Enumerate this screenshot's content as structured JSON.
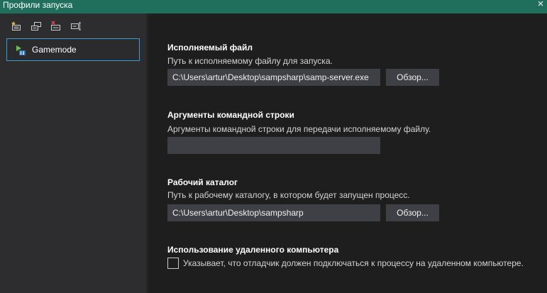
{
  "window": {
    "title": "Профили запуска",
    "close_glyph": "×",
    "accent_color": "#1f6f5c"
  },
  "toolbar": {
    "buttons": [
      {
        "name": "new-profile-icon"
      },
      {
        "name": "copy-profile-icon"
      },
      {
        "name": "delete-profile-icon"
      },
      {
        "name": "rename-profile-icon"
      }
    ]
  },
  "profiles": [
    {
      "label": "Gamemode",
      "icon": "run-profile-icon",
      "selected": true
    }
  ],
  "sections": {
    "executable": {
      "title": "Исполняемый файл",
      "description": "Путь к исполняемому файлу для запуска.",
      "value": "C:\\Users\\artur\\Desktop\\sampsharp\\samp-server.exe",
      "browse_label": "Обзор..."
    },
    "arguments": {
      "title": "Аргументы командной строки",
      "description": "Аргументы командной строки для передачи исполняемому файлу.",
      "value": ""
    },
    "working_dir": {
      "title": "Рабочий каталог",
      "description": "Путь к рабочему каталогу, в котором будет запущен процесс.",
      "value": "C:\\Users\\artur\\Desktop\\sampsharp",
      "browse_label": "Обзор..."
    },
    "remote": {
      "title": "Использование удаленного компьютера",
      "checkbox_label": "Указывает, что отладчик должен подключаться к процессу на удаленном компьютере.",
      "checked": false
    }
  }
}
